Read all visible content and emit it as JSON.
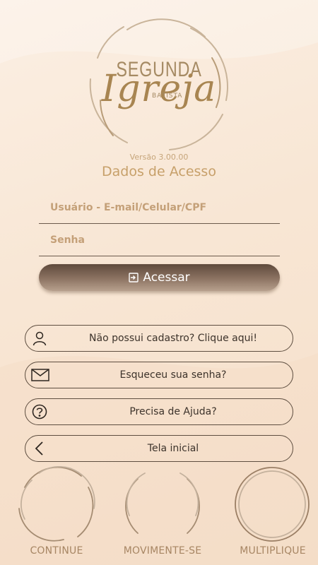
{
  "logo": {
    "line1": "SEGUNDA",
    "line2": "Igreja",
    "line3": "BATISTA"
  },
  "version": "Versão 3.00.00",
  "title": "Dados de Acesso",
  "form": {
    "user_placeholder": "Usuário - E-mail/Celular/CPF",
    "password_placeholder": "Senha",
    "access_label": "Acessar"
  },
  "options": [
    {
      "icon": "user-icon",
      "label": "Não possui cadastro? Clique aqui!"
    },
    {
      "icon": "envelope-icon",
      "label": "Esqueceu sua senha?"
    },
    {
      "icon": "question-icon",
      "label": "Precisa de Ajuda?"
    },
    {
      "icon": "chevron-left-icon",
      "label": "Tela inicial"
    }
  ],
  "bottom_nav": [
    {
      "label": "CONTINUE"
    },
    {
      "label": "MOVIMENTE-SE"
    },
    {
      "label": "MULTIPLIQUE"
    }
  ],
  "colors": {
    "accent_gold": "#c7a06a",
    "button_dark": "#5f4a3c",
    "outline": "#5e4e40"
  }
}
